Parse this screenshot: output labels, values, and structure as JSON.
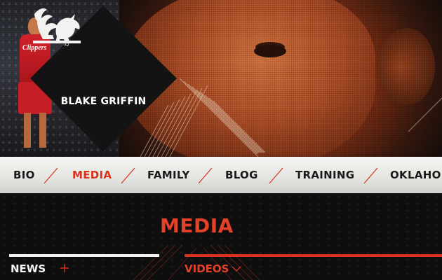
{
  "logo": {
    "name": "BLAKE GRIFFIN",
    "emblem_number": "32",
    "icon": "griffin-icon"
  },
  "hero": {
    "player_jersey_text": "Clippers"
  },
  "nav": {
    "items": [
      {
        "label": "BIO",
        "active": false
      },
      {
        "label": "MEDIA",
        "active": true
      },
      {
        "label": "FAMILY",
        "active": false
      },
      {
        "label": "BLOG",
        "active": false
      },
      {
        "label": "TRAINING",
        "active": false
      },
      {
        "label": "OKLAHOMA",
        "active": false
      }
    ]
  },
  "page": {
    "title": "MEDIA"
  },
  "sections": {
    "news": {
      "label": "NEWS",
      "icon": "plus-icon"
    },
    "videos": {
      "label": "VIDEOS",
      "icon": "chevron-down-icon"
    }
  },
  "colors": {
    "accent": "#d8321c",
    "dark": "#0e0e0e",
    "nav_bg": "#e8e8e6",
    "text_dark": "#1a1a1a"
  }
}
